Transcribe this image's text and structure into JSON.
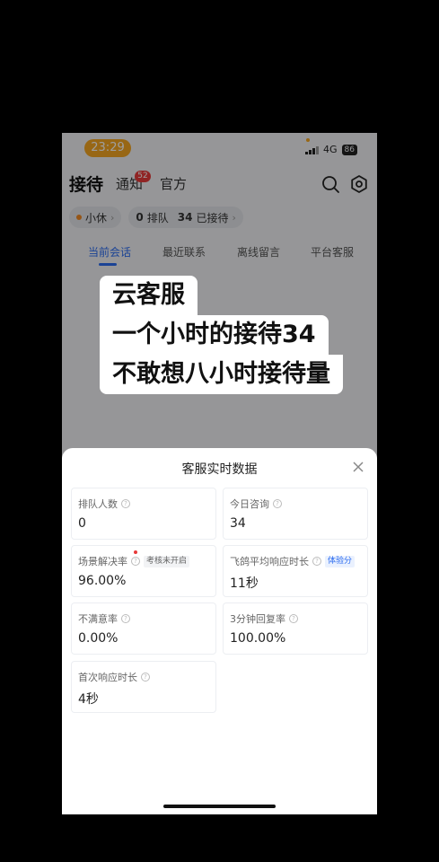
{
  "status": {
    "time": "23:29",
    "network": "4G",
    "battery": "86"
  },
  "nav": {
    "tabs": [
      {
        "label": "接待"
      },
      {
        "label": "通知"
      },
      {
        "label": "官方"
      }
    ],
    "notify_badge": "52"
  },
  "subbar": {
    "status_label": "小休",
    "queue_count": "0",
    "queue_label": "排队",
    "served_count": "34",
    "served_label": "已接待"
  },
  "tabs": [
    {
      "label": "当前会话"
    },
    {
      "label": "最近联系"
    },
    {
      "label": "离线留言"
    },
    {
      "label": "平台客服"
    }
  ],
  "caption": {
    "line1": "云客服",
    "line2": "一个小时的接待34",
    "line3": "不敢想八小时接待量"
  },
  "sheet": {
    "title": "客服实时数据",
    "cards": [
      {
        "label": "排队人数",
        "value": "0"
      },
      {
        "label": "今日咨询",
        "value": "34"
      },
      {
        "label": "场景解决率",
        "value": "96.00%",
        "tag": "考核未开启"
      },
      {
        "label": "飞鸽平均响应时长",
        "value": "11秒",
        "tag": "体验分"
      },
      {
        "label": "不满意率",
        "value": "0.00%"
      },
      {
        "label": "3分钟回复率",
        "value": "100.00%"
      },
      {
        "label": "首次响应时长",
        "value": "4秒"
      }
    ]
  },
  "colors": {
    "accent": "#2c6cf0",
    "time_pill": "#f5a623",
    "badge": "#e83a3a"
  }
}
